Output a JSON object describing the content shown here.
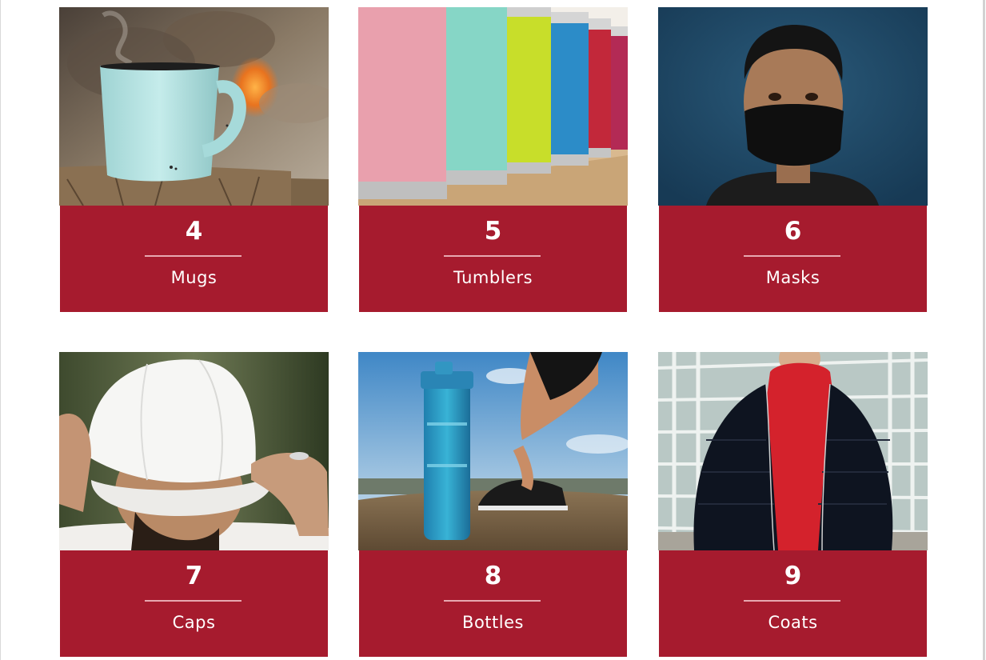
{
  "products": [
    {
      "number": "4",
      "name": "Mugs",
      "image": "mug-photo"
    },
    {
      "number": "5",
      "name": "Tumblers",
      "image": "tumblers-photo"
    },
    {
      "number": "6",
      "name": "Masks",
      "image": "mask-photo"
    },
    {
      "number": "7",
      "name": "Caps",
      "image": "cap-photo"
    },
    {
      "number": "8",
      "name": "Bottles",
      "image": "bottle-photo"
    },
    {
      "number": "9",
      "name": "Coats",
      "image": "coat-photo"
    }
  ],
  "colors": {
    "label_background": "#a61b2e",
    "label_text": "#ffffff",
    "divider": "#e7a8b0"
  }
}
